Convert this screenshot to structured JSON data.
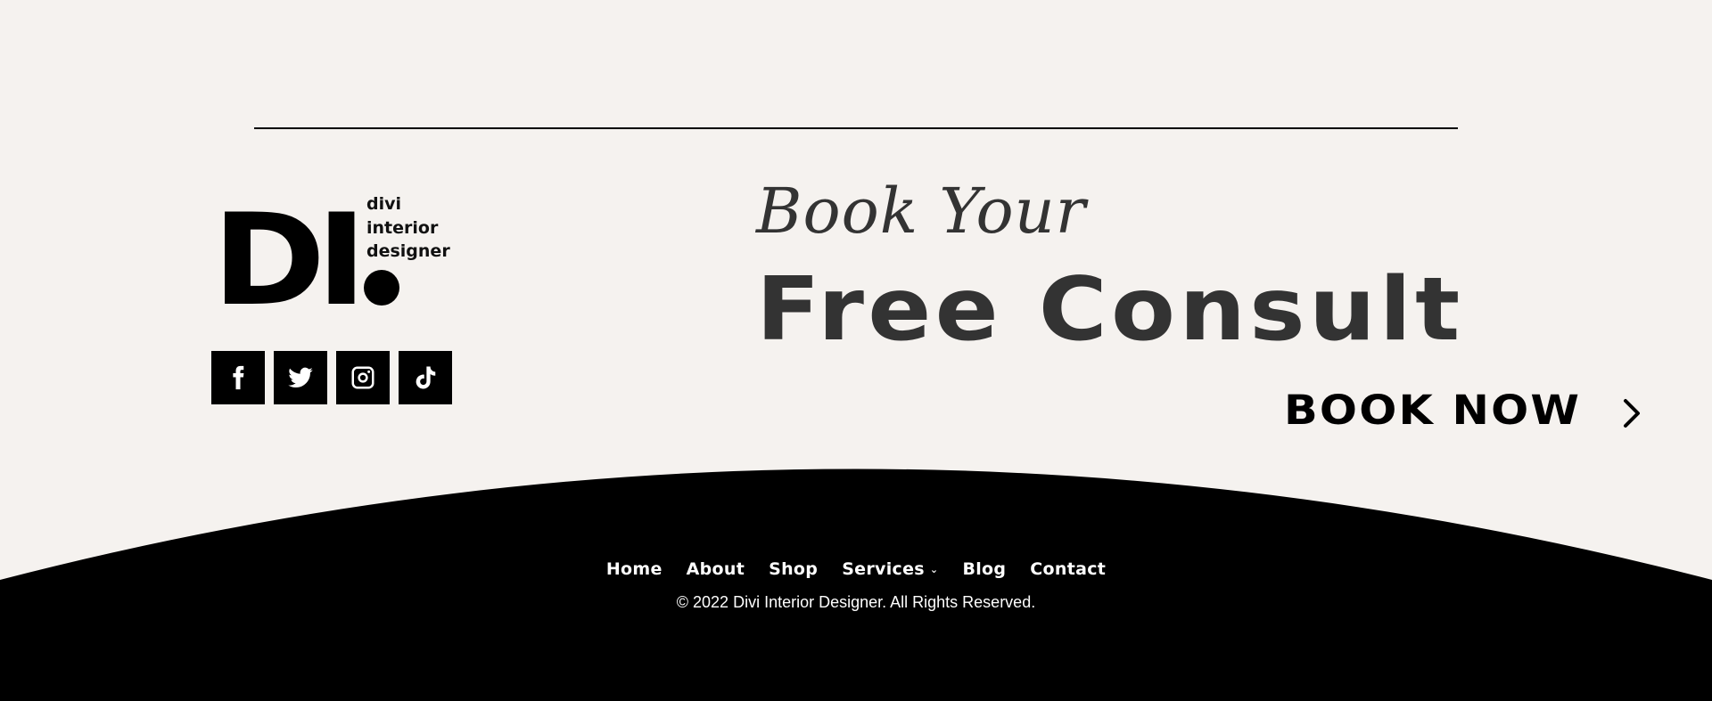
{
  "logo": {
    "mark": "DI",
    "text_lines": [
      "divi",
      "interior",
      "designer"
    ]
  },
  "social": [
    {
      "name": "facebook",
      "icon": "facebook-icon"
    },
    {
      "name": "twitter",
      "icon": "twitter-icon"
    },
    {
      "name": "instagram",
      "icon": "instagram-icon"
    },
    {
      "name": "tiktok",
      "icon": "tiktok-icon"
    }
  ],
  "cta": {
    "script_heading": "Book Your",
    "main_heading": "Free Consult",
    "button_label": "BOOK NOW",
    "button_icon": "chevron-right-icon"
  },
  "footer": {
    "nav": [
      {
        "label": "Home"
      },
      {
        "label": "About"
      },
      {
        "label": "Shop"
      },
      {
        "label": "Services",
        "has_dropdown": true
      },
      {
        "label": "Blog"
      },
      {
        "label": "Contact"
      }
    ],
    "copyright": "© 2022 Divi Interior Designer. All Rights Reserved."
  },
  "colors": {
    "background": "#f5f2ef",
    "text_dark": "#333333",
    "footer_bg": "#000000",
    "footer_text": "#ffffff"
  }
}
